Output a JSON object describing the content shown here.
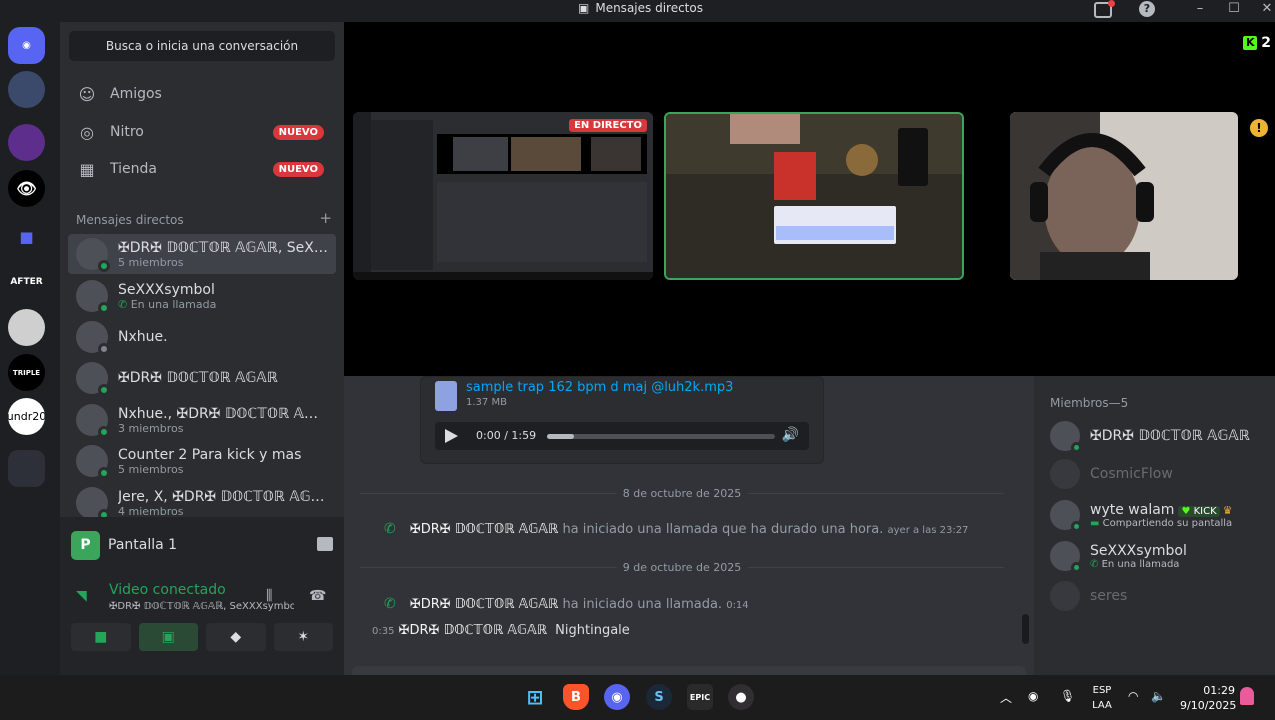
{
  "window": {
    "title": "Mensajes directos"
  },
  "servers": [
    "AFTER",
    "TRIPLE",
    "undr20"
  ],
  "sidebar": {
    "search_placeholder": "Busca o inicia una conversación",
    "nav": [
      {
        "label": "Amigos",
        "icon": "friends-icon"
      },
      {
        "label": "Nitro",
        "icon": "nitro-icon",
        "badge": "NUEVO"
      },
      {
        "label": "Tienda",
        "icon": "shop-icon",
        "badge": "NUEVO"
      }
    ],
    "dm_header": "Mensajes directos",
    "dm_add": "+",
    "dms": [
      {
        "name": "✠DR✠ 𝔻𝕆ℂ𝕋𝕆ℝ 𝔸𝔾𝔸ℝ, SeX…",
        "sub": "5 miembros",
        "active": true
      },
      {
        "name": "SeXXXsymbol",
        "sub": "En una llamada"
      },
      {
        "name": "Nxhue.",
        "sub": ""
      },
      {
        "name": "✠DR✠ 𝔻𝕆ℂ𝕋𝕆ℝ 𝔸𝔾𝔸ℝ",
        "sub": ""
      },
      {
        "name": "Nxhue., ✠DR✠ 𝔻𝕆ℂ𝕋𝕆ℝ 𝔸𝔾…",
        "sub": "3 miembros"
      },
      {
        "name": "Counter 2 Para kick y mas",
        "sub": "5 miembros"
      },
      {
        "name": "Jere, X, ✠DR✠ 𝔻𝕆ℂ𝕋𝕆ℝ 𝔸𝔾…",
        "sub": "4 miembros"
      }
    ]
  },
  "voice": {
    "stream_icon_letter": "P",
    "stream_label": "Pantalla 1",
    "status": "Video conectado",
    "channel": "✠DR✠ 𝔻𝕆ℂ𝕋𝕆ℝ 𝔸𝔾𝔸ℝ, SeXXXsymbol, ..."
  },
  "stage": {
    "live_label": "EN DIRECTO",
    "kick_count": "2",
    "kick_letter": "K",
    "warning": "!"
  },
  "chat": {
    "file": {
      "name": "sample trap 162 bpm d maj @luh2k.mp3",
      "size": "1.37 MB",
      "time": "0:00 / 1:59",
      "progress": 0.12
    },
    "date1": "8 de octubre de 2025",
    "call1": {
      "who": "✠DR✠ 𝔻𝕆ℂ𝕋𝕆ℝ 𝔸𝔾𝔸ℝ",
      "text": "ha iniciado una llamada que ha durado una hora.",
      "ts": "ayer a las 23:27"
    },
    "date2": "9 de octubre de 2025",
    "call2": {
      "who": "✠DR✠ 𝔻𝕆ℂ𝕋𝕆ℝ 𝔸𝔾𝔸ℝ",
      "text": "ha iniciado una llamada.",
      "ts": "0:14"
    },
    "msg": {
      "ts": "0:35",
      "who": "✠DR✠ 𝔻𝕆ℂ𝕋𝕆ℝ 𝔸𝔾𝔸ℝ",
      "text": "Nightingale"
    }
  },
  "members": {
    "header": "Miembros—5",
    "list": [
      {
        "name": "✠DR✠ 𝔻𝕆ℂ𝕋𝕆ℝ 𝔸𝔾𝔸ℝ",
        "sub": "",
        "online": true
      },
      {
        "name": "CosmicFlow",
        "sub": "",
        "online": false
      },
      {
        "name": "wyte walam",
        "tag": "KICK",
        "sub": "Compartiendo su pantalla",
        "online": true
      },
      {
        "name": "SeXXXsymbol",
        "sub": "En una llamada",
        "online": true
      },
      {
        "name": "seres",
        "sub": "",
        "online": false
      }
    ]
  },
  "taskbar": {
    "lang_top": "ESP",
    "lang_bottom": "LAA",
    "time": "01:29",
    "date": "9/10/2025",
    "apps": [
      "windows-start-icon",
      "brave-icon",
      "discord-icon",
      "steam-icon",
      "epic-games-icon",
      "obs-icon"
    ]
  }
}
